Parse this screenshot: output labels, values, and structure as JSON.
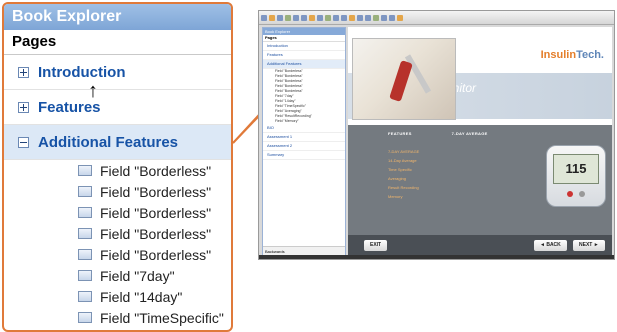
{
  "zoom_panel": {
    "title": "Book Explorer",
    "pages_label": "Pages",
    "sections": [
      {
        "label": "Introduction",
        "expanded": false
      },
      {
        "label": "Features",
        "expanded": false
      },
      {
        "label": "Additional Features",
        "expanded": true
      }
    ],
    "fields": [
      "Field \"Borderless\"",
      "Field \"Borderless\"",
      "Field \"Borderless\"",
      "Field \"Borderless\"",
      "Field \"Borderless\"",
      "Field \"7day\"",
      "Field \"14day\"",
      "Field \"TimeSpecific\""
    ]
  },
  "thumbnail": {
    "explorer": {
      "title": "Book Explorer",
      "pages_label": "Pages",
      "sections_top": [
        "Introduction",
        "Features",
        "Additional Features"
      ],
      "fields": [
        "Field \"Borderless\"",
        "Field \"Borderless\"",
        "Field \"Borderless\"",
        "Field \"Borderless\"",
        "Field \"Borderless\"",
        "Field \"7day\"",
        "Field \"14day\"",
        "Field \"TimeSpecific\"",
        "Field \"Averaging\"",
        "Field \"ResultRecording\"",
        "Field \"Memory\""
      ],
      "sections_bottom": [
        "BIO",
        "Assessment 1",
        "Assessment 2",
        "Summary"
      ],
      "footer": "Backwards"
    },
    "brand": {
      "insulin": "Insulin",
      "tech": "Tech."
    },
    "banner_heading": "Monitor",
    "panel_columns": [
      "FEATURES",
      "7-DAY AVERAGE"
    ],
    "panel_links": [
      "7-DAY AVERAGE",
      "14-Day Average",
      "Time Specific",
      "Averaging",
      "Result Recording",
      "Memory"
    ],
    "meter_reading": "115",
    "buttons": {
      "exit": "EXIT",
      "back": "◄ BACK",
      "next": "NEXT ►"
    }
  },
  "colors": {
    "accent": "#e07a3a",
    "link": "#1753a6",
    "title_bar": "#86a9d8"
  }
}
